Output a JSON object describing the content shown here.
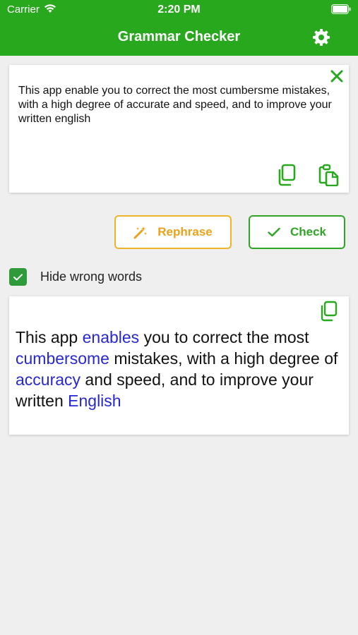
{
  "status_bar": {
    "carrier": "Carrier",
    "time": "2:20 PM"
  },
  "nav": {
    "title": "Grammar Checker"
  },
  "input": {
    "text": "This app enable you to correct the most cumbersme mistakes, with a high degree of accurate and speed, and to improve your written english"
  },
  "actions": {
    "rephrase_label": "Rephrase",
    "check_label": "Check"
  },
  "options": {
    "hide_wrong_words_label": "Hide wrong words",
    "hide_wrong_words_checked": true
  },
  "result": {
    "segments": [
      {
        "text": "This app ",
        "corrected": false
      },
      {
        "text": "enables",
        "corrected": true
      },
      {
        "text": " you to correct the most ",
        "corrected": false
      },
      {
        "text": "cumbersome",
        "corrected": true
      },
      {
        "text": " mistakes, with a high degree of ",
        "corrected": false
      },
      {
        "text": "accuracy",
        "corrected": true
      },
      {
        "text": " and speed, and to improve your written ",
        "corrected": false
      },
      {
        "text": "English",
        "corrected": true
      }
    ]
  },
  "colors": {
    "brand_green": "#27a81d",
    "rephrase_accent": "#f1b329",
    "check_accent": "#2fa526",
    "correction_blue": "#2727d4",
    "checkbox_green": "#2f9a39"
  },
  "icons": [
    "wifi-icon",
    "battery-icon",
    "gear-icon",
    "close-icon",
    "copy-icon",
    "paste-icon",
    "magic-wand-icon",
    "checkmark-icon"
  ]
}
